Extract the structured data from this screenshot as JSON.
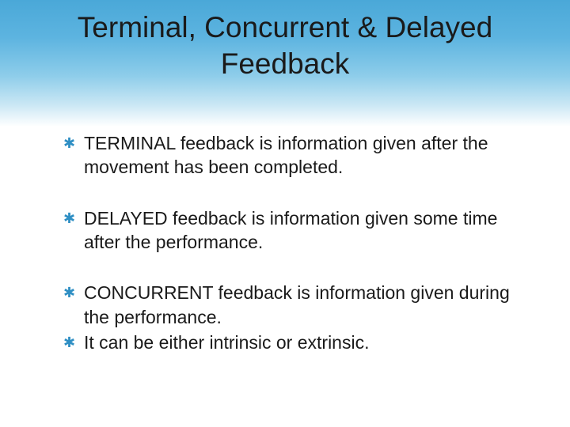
{
  "title": "Terminal, Concurrent & Delayed Feedback",
  "bullets": {
    "group1": {
      "item1": "TERMINAL feedback is information given after the movement has been completed."
    },
    "group2": {
      "item1": "DELAYED feedback is information given some time after the performance."
    },
    "group3": {
      "item1": "CONCURRENT feedback is information given during the performance.",
      "item2": "It can be either intrinsic or extrinsic."
    }
  }
}
